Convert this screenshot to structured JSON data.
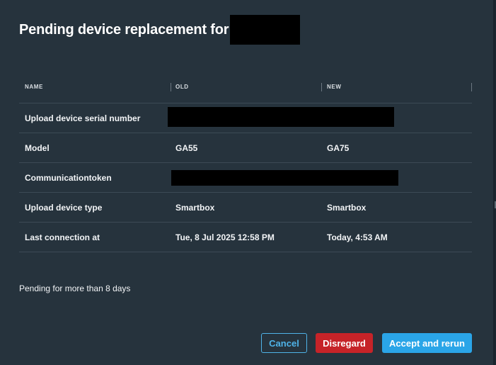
{
  "dialog": {
    "title": "Pending device replacement for"
  },
  "table": {
    "columns": [
      "NAME",
      "OLD",
      "NEW"
    ],
    "rows": [
      {
        "name": "Upload device serial number",
        "old": "",
        "new": ""
      },
      {
        "name": "Model",
        "old": "GA55",
        "new": "GA75"
      },
      {
        "name": "Communicationtoken",
        "old": "",
        "new": ""
      },
      {
        "name": "Upload device type",
        "old": "Smartbox",
        "new": "Smartbox"
      },
      {
        "name": "Last connection at",
        "old": "Tue, 8 Jul 2025 12:58 PM",
        "new": "Today, 4:53 AM"
      }
    ]
  },
  "pending_note": "Pending for more than 8 days",
  "buttons": {
    "cancel": "Cancel",
    "disregard": "Disregard",
    "accept": "Accept and rerun"
  },
  "colors": {
    "dialog_bg": "#26333d",
    "divider": "#3c4a55",
    "primary": "#2aa5e8",
    "danger": "#c62328"
  }
}
